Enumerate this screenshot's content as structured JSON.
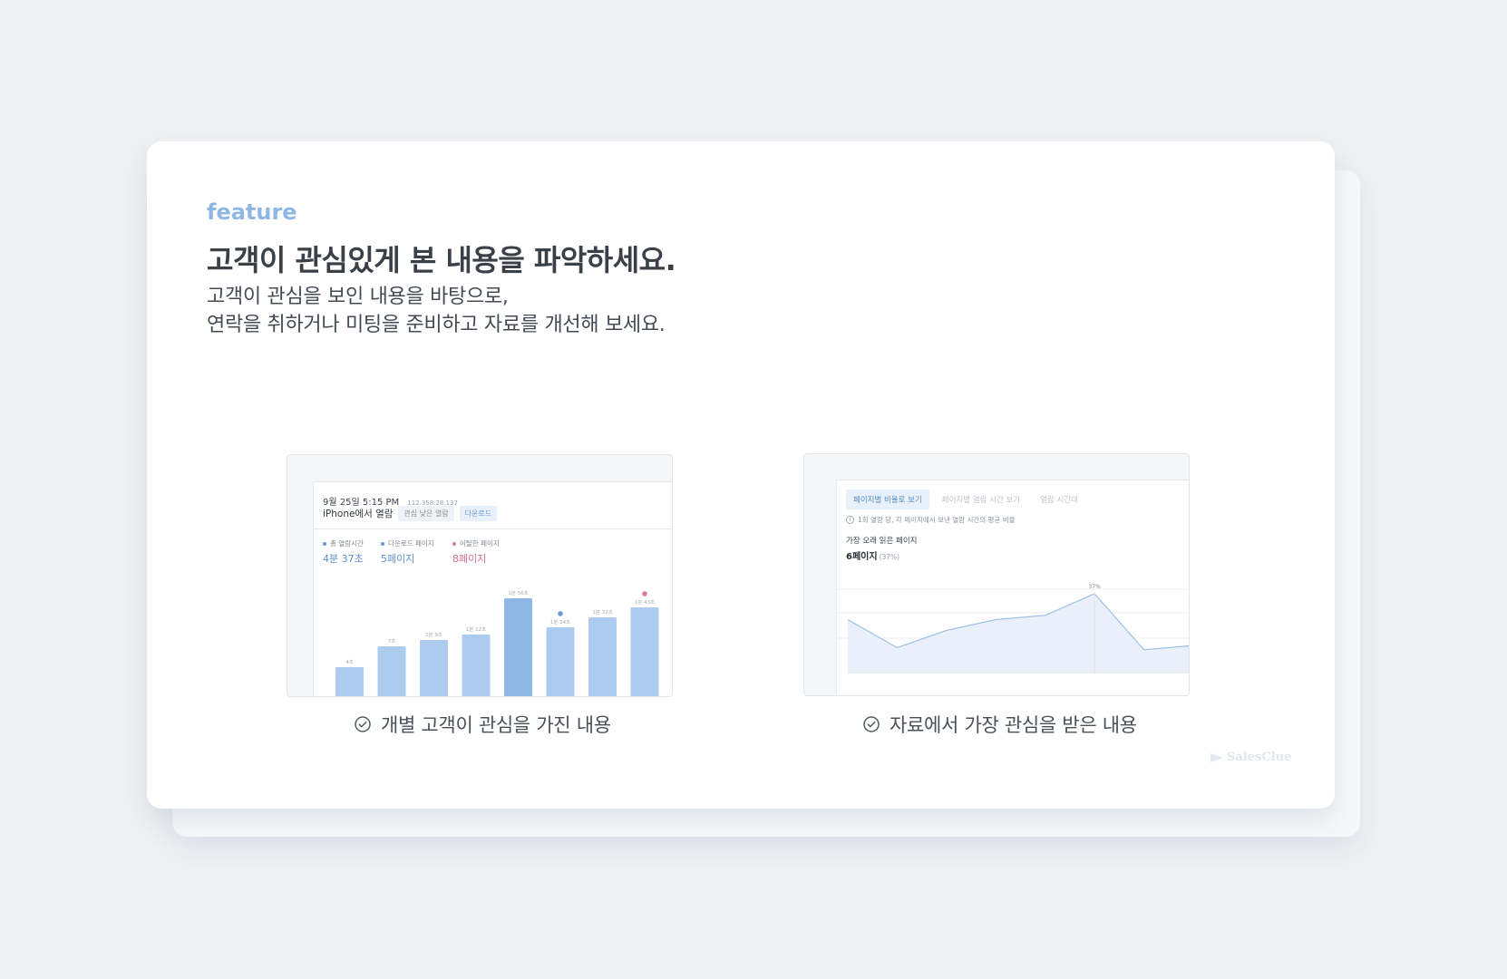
{
  "brand": {
    "accent": "#8fb7e4",
    "logo_text": "SalesClue"
  },
  "header": {
    "eyebrow": "feature",
    "headline": "고객이 관심있게 본 내용을 파악하세요.",
    "description_line1": "고객이 관심을 보인 내용을 바탕으로,",
    "description_line2": "연락을 취하거나 미팅을 준비하고 자료를 개선해 보세요."
  },
  "screenshot_left": {
    "date": "9월 25일 5:15 PM",
    "ip": "112.358.28.137",
    "title": "iPhone에서 열람",
    "chip_interest": "관심 낮은 열람",
    "chip_download": "다운로드",
    "stats": [
      {
        "label": "총 열람시간",
        "value": "4분 37초",
        "color": "#6c9ad1"
      },
      {
        "label": "다운로드 페이지",
        "value": "5페이지",
        "color": "#6c9ad1"
      },
      {
        "label": "이탈한 페이지",
        "value": "8페이지",
        "color": "#d97a97"
      }
    ],
    "bars": {
      "labels": [
        "4초",
        "7초",
        "1분 9초",
        "1분 12초",
        "1분 56초",
        "1분 24초",
        "1분 32초",
        "1분 43초"
      ],
      "values": [
        34,
        57,
        64,
        70,
        110,
        78,
        89,
        100
      ],
      "highlight_index": 4,
      "download_index": 5,
      "exit_index": 7
    }
  },
  "screenshot_right": {
    "tabs": [
      "페이지별 비율로 보기",
      "페이지별 열람 시간 보기",
      "열람 시간대"
    ],
    "note": "1회 열람 당, 각 페이지에서 보낸 열람 시간의 평균 비율",
    "subtitle": "가장 오래 읽은 페이지",
    "value": "6페이지",
    "value_pct": "(37%)",
    "line": {
      "values": [
        25,
        12,
        20,
        25,
        27,
        37,
        11,
        13
      ],
      "peak_label": "37%"
    }
  },
  "captions": {
    "left": "개별 고객이 관심을 가진 내용",
    "right": "자료에서 가장 관심을 받은 내용"
  }
}
